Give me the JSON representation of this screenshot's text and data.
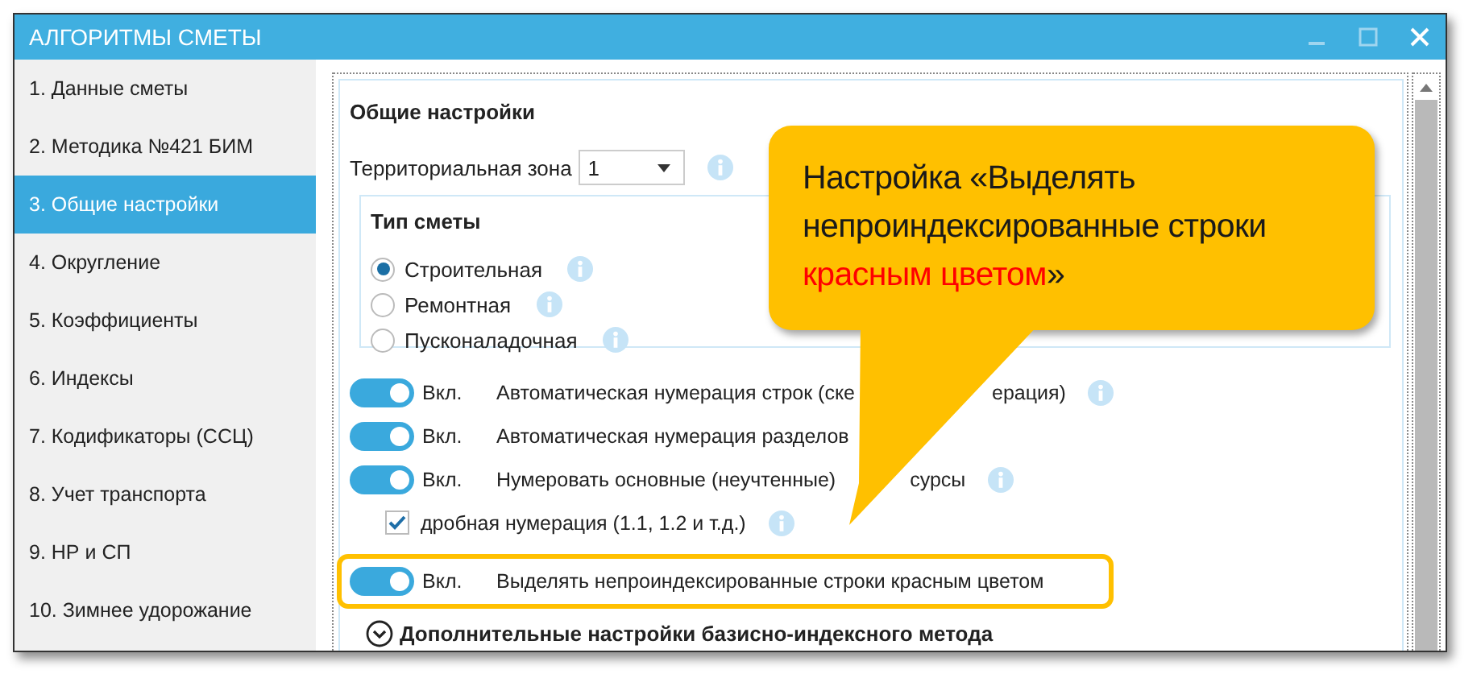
{
  "window": {
    "title": "АЛГОРИТМЫ СМЕТЫ"
  },
  "sidebar": {
    "items": [
      {
        "label": "1. Данные сметы",
        "selected": false
      },
      {
        "label": "2. Методика №421 БИМ",
        "selected": false
      },
      {
        "label": "3. Общие настройки",
        "selected": true
      },
      {
        "label": "4. Округление",
        "selected": false
      },
      {
        "label": "5. Коэффициенты",
        "selected": false
      },
      {
        "label": "6. Индексы",
        "selected": false
      },
      {
        "label": "7. Кодификаторы (ССЦ)",
        "selected": false
      },
      {
        "label": "8. Учет транспорта",
        "selected": false
      },
      {
        "label": "9. НР и СП",
        "selected": false
      },
      {
        "label": "10. Зимнее удорожание",
        "selected": false
      }
    ]
  },
  "settings": {
    "title": "Общие настройки",
    "zone": {
      "label": "Территориальная зона",
      "value": "1"
    },
    "estimate_type": {
      "title": "Тип сметы",
      "options": [
        {
          "label": "Строительная",
          "selected": true
        },
        {
          "label": "Ремонтная",
          "selected": false
        },
        {
          "label": "Пусконаладочная",
          "selected": false
        }
      ]
    },
    "options": [
      {
        "kind": "toggle",
        "on": true,
        "state_label": "Вкл.",
        "label": "Автоматическая нумерация строк (ске",
        "label_tail": "ерация)",
        "info": true,
        "highlighted": false
      },
      {
        "kind": "toggle",
        "on": true,
        "state_label": "Вкл.",
        "label": "Автоматическая нумерация разделов",
        "info": false,
        "highlighted": false
      },
      {
        "kind": "toggle",
        "on": true,
        "state_label": "Вкл.",
        "label": "Нумеровать основные (неучтенные)",
        "label_tail": "сурсы",
        "info": true,
        "highlighted": false
      },
      {
        "kind": "checkbox",
        "checked": true,
        "label": "дробная нумерация (1.1, 1.2 и т.д.)",
        "info": true,
        "highlighted": false
      },
      {
        "kind": "toggle",
        "on": true,
        "state_label": "Вкл.",
        "label": "Выделять непроиндексированные строки красным цветом",
        "info": false,
        "highlighted": true
      }
    ],
    "expander": {
      "label": "Дополнительные настройки базисно-индексного метода",
      "expanded": false
    }
  },
  "callout": {
    "parts": [
      {
        "text": "Настройка «Выделять непроиндексированные строки ",
        "color": "#1a1a1a"
      },
      {
        "text": "красным цветом",
        "color": "#ff0000"
      },
      {
        "text": "»",
        "color": "#1a1a1a"
      }
    ]
  }
}
